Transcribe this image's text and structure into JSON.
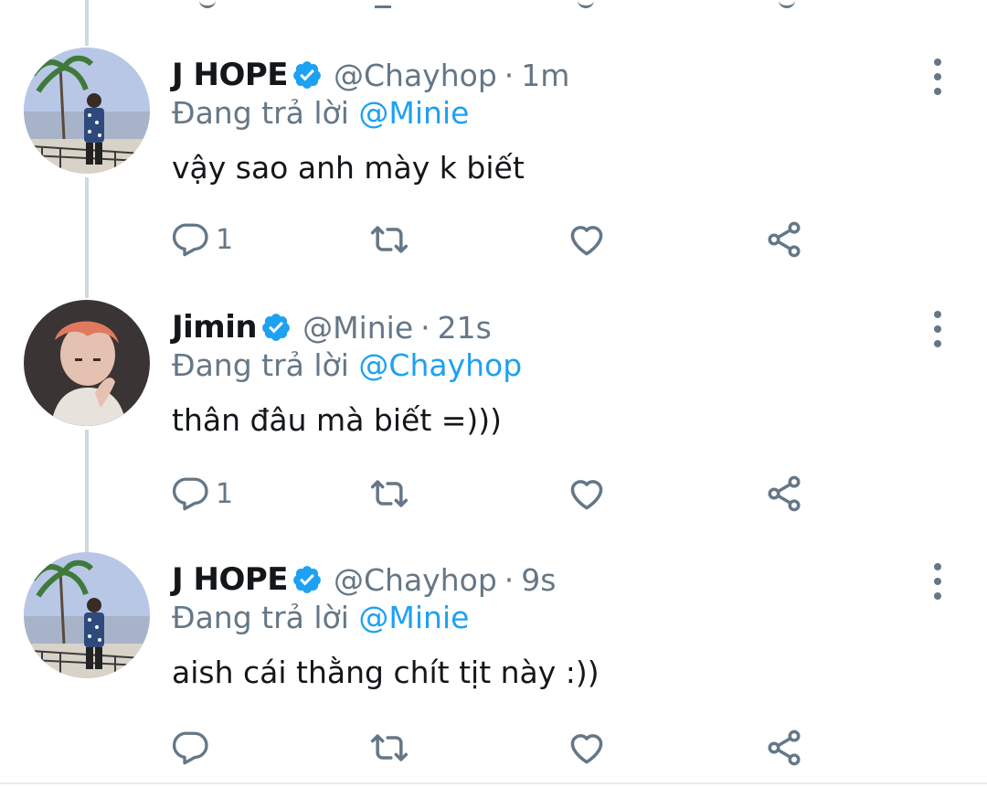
{
  "icons": {
    "verified": "verified-badge-icon",
    "reply": "reply-icon",
    "retweet": "retweet-icon",
    "like": "heart-icon",
    "share": "share-icon",
    "more": "more-vertical-icon"
  },
  "colors": {
    "accent": "#1da1f2",
    "secondary_text": "#657786",
    "thread_line": "#cfd9de"
  },
  "tweets": [
    {
      "name": "J HOPE",
      "handle": "@Chayhop",
      "separator": "·",
      "time": "1m",
      "reply_prefix": "Đang trả lời",
      "reply_to": "@Minie",
      "text": "vậy sao anh mày k biết",
      "reply_count": "1"
    },
    {
      "name": "Jimin",
      "handle": "@Minie",
      "separator": "·",
      "time": "21s",
      "reply_prefix": "Đang trả lời",
      "reply_to": "@Chayhop",
      "text": "thân đâu mà biết =)))",
      "reply_count": "1"
    },
    {
      "name": "J HOPE",
      "handle": "@Chayhop",
      "separator": "·",
      "time": "9s",
      "reply_prefix": "Đang trả lời",
      "reply_to": "@Minie",
      "text": "aish cái thằng chít tịt này :))",
      "reply_count": ""
    }
  ]
}
